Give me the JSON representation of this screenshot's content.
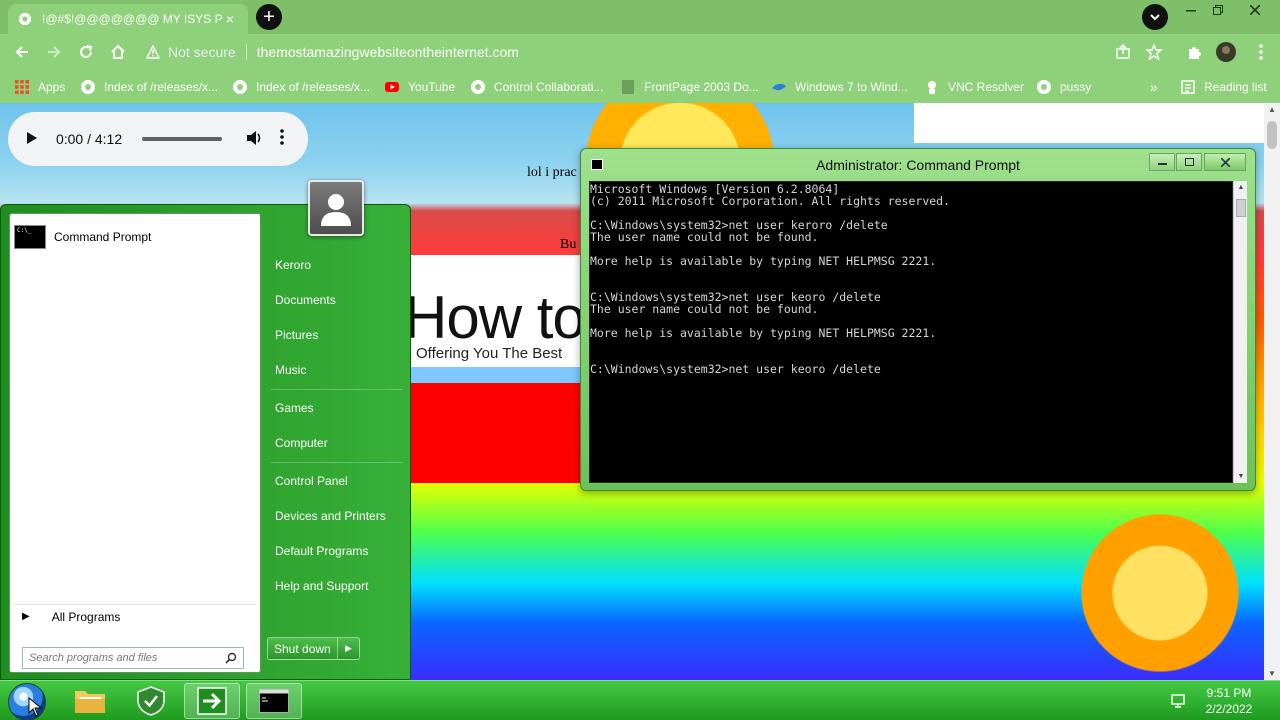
{
  "browser": {
    "tab_title": "!@#$!@@@@@@@ MY ISYS PR",
    "tab_close": "×",
    "new_tab": "+",
    "security_label": "Not secure",
    "url": "themostamazingwebsiteontheinternet.com",
    "bookmarks": [
      {
        "label": "Apps",
        "icon": "apps-grid-icon"
      },
      {
        "label": "Index of /releases/x...",
        "icon": "globe-icon"
      },
      {
        "label": "Index of /releases/x...",
        "icon": "globe-icon"
      },
      {
        "label": "YouTube",
        "icon": "youtube-icon"
      },
      {
        "label": "Control Collaborati...",
        "icon": "globe-icon"
      },
      {
        "label": "FrontPage 2003 Do...",
        "icon": "page-icon"
      },
      {
        "label": "Windows 7 to Wind...",
        "icon": "windows-icon"
      },
      {
        "label": "VNC Resolver",
        "icon": "vnc-icon"
      },
      {
        "label": "pussy",
        "icon": "globe-icon"
      }
    ],
    "bookmarks_overflow": "»",
    "reading_list": "Reading list"
  },
  "page": {
    "text1": "lol i prac",
    "text2": "Bu",
    "banner_big": "How to",
    "banner_small": "Offering You The Best"
  },
  "audio": {
    "time": "0:00 / 4:12",
    "progress": 0
  },
  "start_menu": {
    "pinned": [
      {
        "label": "Command Prompt",
        "icon": "command-prompt-icon"
      }
    ],
    "all_programs": "All Programs",
    "search_placeholder": "Search programs and files",
    "right_items": [
      {
        "label": "Keroro"
      },
      {
        "label": "Documents"
      },
      {
        "label": "Pictures"
      },
      {
        "label": "Music"
      },
      {
        "label": "Games"
      },
      {
        "label": "Computer"
      },
      {
        "label": "Control Panel"
      },
      {
        "label": "Devices and Printers"
      },
      {
        "label": "Default Programs"
      },
      {
        "label": "Help and Support"
      }
    ],
    "shutdown": "Shut down"
  },
  "cmd": {
    "title": "Administrator: Command Prompt",
    "lines": [
      "Microsoft Windows [Version 6.2.8064]",
      "(c) 2011 Microsoft Corporation. All rights reserved.",
      "",
      "C:\\Windows\\system32>net user keroro /delete",
      "The user name could not be found.",
      "",
      "More help is available by typing NET HELPMSG 2221.",
      "",
      "",
      "C:\\Windows\\system32>net user keoro /delete",
      "The user name could not be found.",
      "",
      "More help is available by typing NET HELPMSG 2221.",
      "",
      "",
      "C:\\Windows\\system32>net user keoro /delete"
    ]
  },
  "taskbar": {
    "time": "9:51 PM",
    "date": "2/2/2022"
  }
}
